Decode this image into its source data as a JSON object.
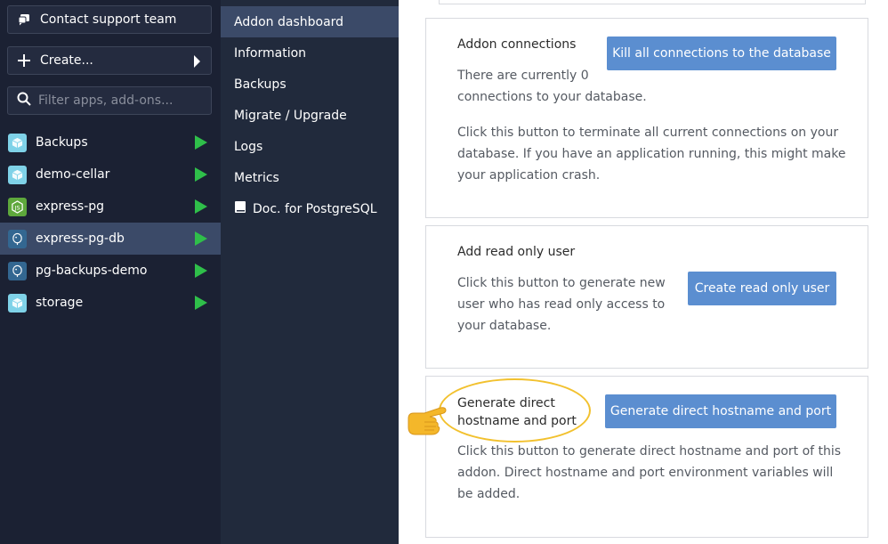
{
  "sidebar": {
    "contact_label": "Contact support team",
    "create_label": "Create...",
    "search_placeholder": "Filter apps, add-ons...",
    "apps": [
      {
        "name": "Backups",
        "icon": "cube-icon"
      },
      {
        "name": "demo-cellar",
        "icon": "cube-icon"
      },
      {
        "name": "express-pg",
        "icon": "nodejs-icon"
      },
      {
        "name": "express-pg-db",
        "icon": "postgresql-icon",
        "active": true
      },
      {
        "name": "pg-backups-demo",
        "icon": "postgresql-icon"
      },
      {
        "name": "storage",
        "icon": "cube-icon"
      }
    ]
  },
  "addon_nav": {
    "items": [
      "Addon dashboard",
      "Information",
      "Backups",
      "Migrate / Upgrade",
      "Logs",
      "Metrics"
    ],
    "doc_label": "Doc. for PostgreSQL"
  },
  "main": {
    "connections": {
      "title": "Addon connections",
      "status": "There are currently 0 connections to your database.",
      "button": "Kill all connections to the database",
      "description": "Click this button to terminate all current connections on your database. If you have an application running, this might make your application crash."
    },
    "readonly": {
      "title": "Add read only user",
      "description": "Click this button to generate new user who has read only access to your database.",
      "button": "Create read only user"
    },
    "direct": {
      "title": "Generate direct hostname and port",
      "button": "Generate direct hostname and port",
      "description": "Click this button to generate direct hostname and port of this addon. Direct hostname and port environment variables will be added."
    }
  },
  "colors": {
    "sidebar_bg": "#1b2133",
    "nav_bg": "#212a3c",
    "active_bg": "#3b4a68",
    "button_blue": "#5b8ed0",
    "play_green": "#2fbf4a",
    "highlight_yellow": "#f2c12e"
  }
}
